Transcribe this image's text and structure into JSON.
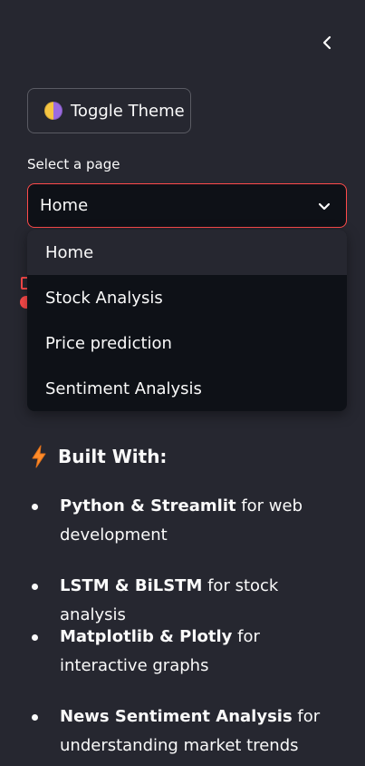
{
  "sidebar": {
    "collapse_icon": "chevron-left-icon",
    "theme_button": {
      "label": "Toggle Theme",
      "icon": "half-moon-icon"
    },
    "select": {
      "label": "Select a page",
      "value": "Home",
      "options": [
        "Home",
        "Stock Analysis",
        "Price prediction",
        "Sentiment Analysis"
      ]
    },
    "built_with": {
      "heading": "Built With:",
      "icon": "lightning-icon",
      "items": [
        {
          "bold": "Python & Streamlit",
          "rest": " for web development"
        },
        {
          "bold": "LSTM & BiLSTM",
          "rest": " for stock analysis"
        },
        {
          "bold": "Matplotlib & Plotly",
          "rest": " for interactive graphs"
        },
        {
          "bold": "News Sentiment Analysis",
          "rest": " for understanding market trends"
        }
      ]
    }
  },
  "colors": {
    "background": "#262730",
    "input_bg": "#0e1117",
    "accent": "#ff4b4b",
    "text": "#fafafa",
    "bolt": "#ff8c2a"
  }
}
